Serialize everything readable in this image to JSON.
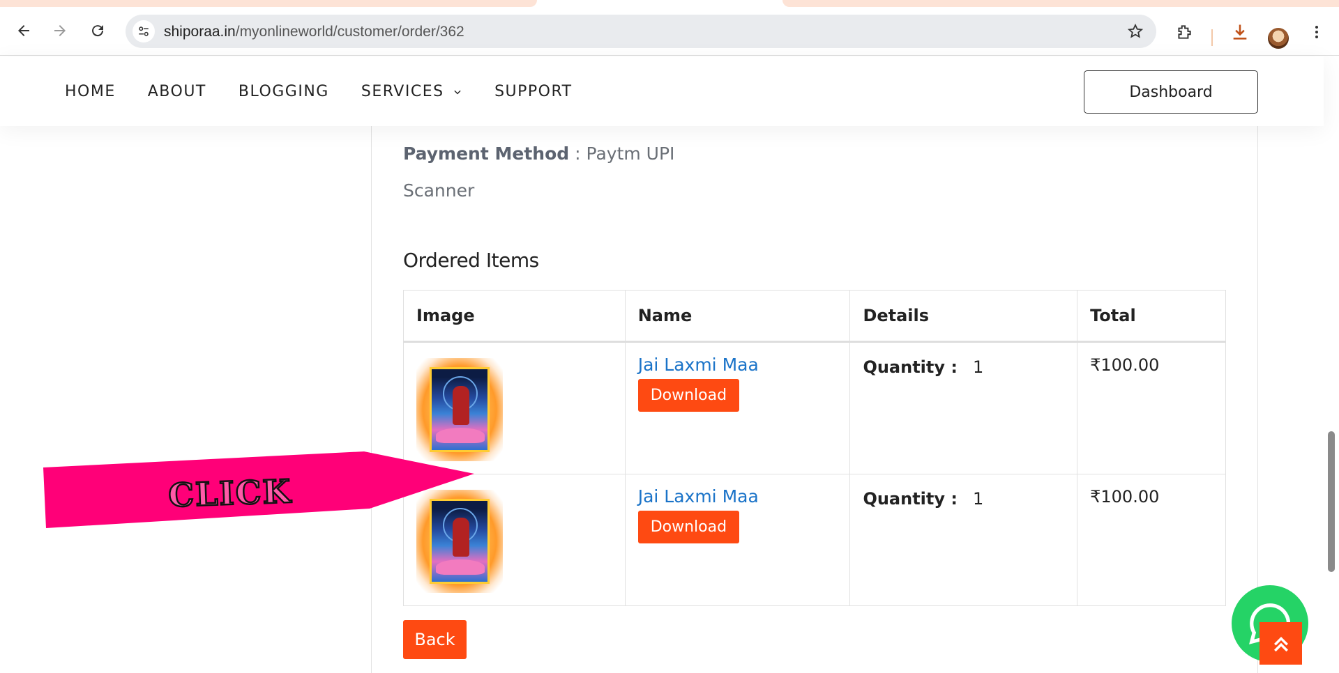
{
  "browser": {
    "url_domain": "shiporaa.in",
    "url_path": "/myonlineworld/customer/order/362"
  },
  "nav": {
    "items": [
      {
        "label": "HOME"
      },
      {
        "label": "ABOUT"
      },
      {
        "label": "BLOGGING"
      },
      {
        "label": "SERVICES"
      },
      {
        "label": "SUPPORT"
      }
    ],
    "dashboard_label": "Dashboard"
  },
  "order": {
    "payment_label": "Payment Method",
    "payment_sep": " : ",
    "payment_value": "Paytm UPI",
    "payment_value_2": "Scanner",
    "items_title": "Ordered Items",
    "columns": [
      "Image",
      "Name",
      "Details",
      "Total"
    ],
    "rows": [
      {
        "name": "Jai Laxmi Maa",
        "download": "Download",
        "qty_label": "Quantity :",
        "qty": "1",
        "total": "₹100.00"
      },
      {
        "name": "Jai Laxmi Maa",
        "download": "Download",
        "qty_label": "Quantity :",
        "qty": "1",
        "total": "₹100.00"
      }
    ],
    "back_label": "Back"
  },
  "annotation": {
    "arrow_text": "CLICK",
    "arrow_color": "#ff0078"
  },
  "colors": {
    "accent": "#fe4a12",
    "link": "#1a73c8",
    "whatsapp": "#25d366"
  },
  "icons": [
    "back-arrow-icon",
    "forward-arrow-icon",
    "reload-icon",
    "site-settings-icon",
    "bookmark-star-icon",
    "extensions-icon",
    "download-icon",
    "menu-dots-icon",
    "chevron-down-icon",
    "whatsapp-icon",
    "scroll-top-icon"
  ]
}
